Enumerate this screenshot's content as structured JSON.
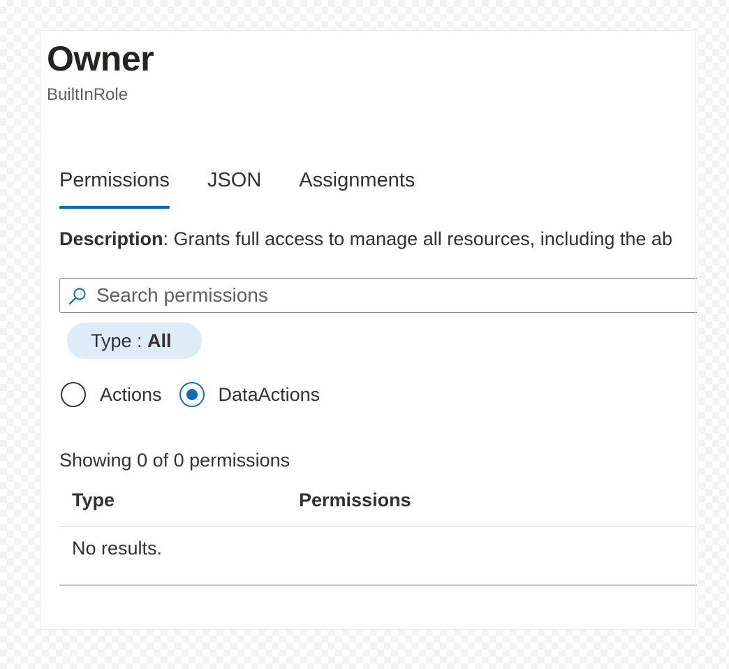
{
  "header": {
    "title": "Owner",
    "subtitle": "BuiltInRole"
  },
  "tabs": [
    {
      "label": "Permissions",
      "active": true
    },
    {
      "label": "JSON",
      "active": false
    },
    {
      "label": "Assignments",
      "active": false
    }
  ],
  "description": {
    "label": "Description",
    "text": ": Grants full access to manage all resources, including the ab"
  },
  "search": {
    "placeholder": "Search permissions",
    "icon": "search-icon"
  },
  "filter": {
    "label": "Type : ",
    "value": "All"
  },
  "radio_options": [
    {
      "label": "Actions",
      "checked": false
    },
    {
      "label": "DataActions",
      "checked": true
    }
  ],
  "results": {
    "summary": "Showing 0 of 0 permissions",
    "columns": [
      "Type",
      "Permissions"
    ],
    "empty_message": "No results."
  },
  "colors": {
    "accent": "#0f6cbd",
    "pill_background": "#deecf9"
  }
}
